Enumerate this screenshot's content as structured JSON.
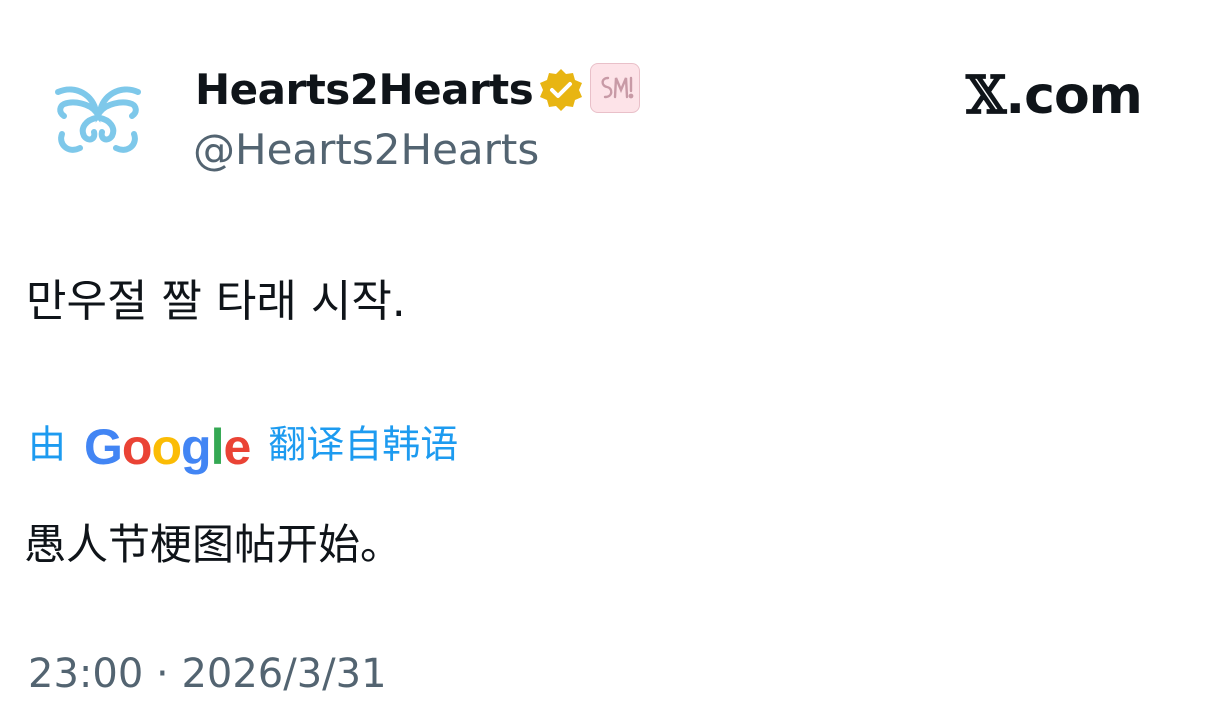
{
  "account": {
    "display_name": "Hearts2Hearts",
    "handle": "@Hearts2Hearts",
    "verified_icon": "gold-verified-badge-icon",
    "affiliate_badge_icon": "sm-entertainment-badge-icon"
  },
  "brand": {
    "x": "𝕏",
    "domain": ".com"
  },
  "tweet": {
    "text": "만우절 짤 타래 시작.",
    "translation": {
      "by": "由",
      "provider_letters": [
        "G",
        "o",
        "o",
        "g",
        "l",
        "e"
      ],
      "suffix": "翻译自韩语",
      "text": "愚人节梗图帖开始。"
    },
    "time": "23:00",
    "separator": "·",
    "date": "2026/3/31"
  },
  "colors": {
    "link_blue": "#1d9bf0",
    "secondary_gray": "#536471",
    "avatar_blue": "#7ec8ea",
    "verified_gold": "#e8b512"
  }
}
